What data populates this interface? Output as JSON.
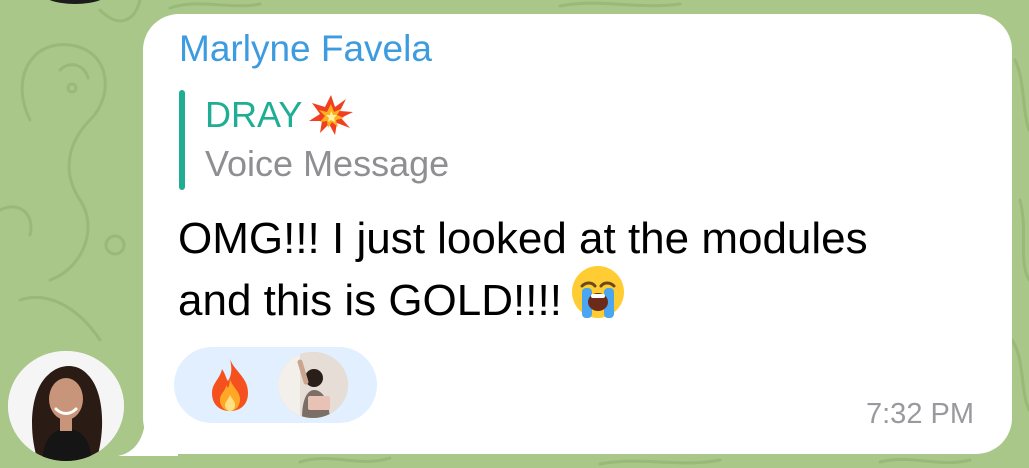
{
  "chat": {
    "sender_name": "Marlyne Favela",
    "reply": {
      "author": "DRAY",
      "author_emoji": "collision-emoji",
      "preview": "Voice Message"
    },
    "message_lines": [
      "OMG!!! I just looked at the modules",
      "and this is GOLD!!!!"
    ],
    "message_emoji": "loudly-crying-face-emoji",
    "reaction": {
      "emoji": "fire-emoji"
    },
    "time": "7:32 PM"
  },
  "colors": {
    "background": "#a9c788",
    "bubble": "#ffffff",
    "sender_name": "#3d9be0",
    "reply_accent": "#1fae93",
    "reply_text": "#8e8e93",
    "reaction_bg": "#e1efff",
    "time_text": "#9a9a9e"
  }
}
